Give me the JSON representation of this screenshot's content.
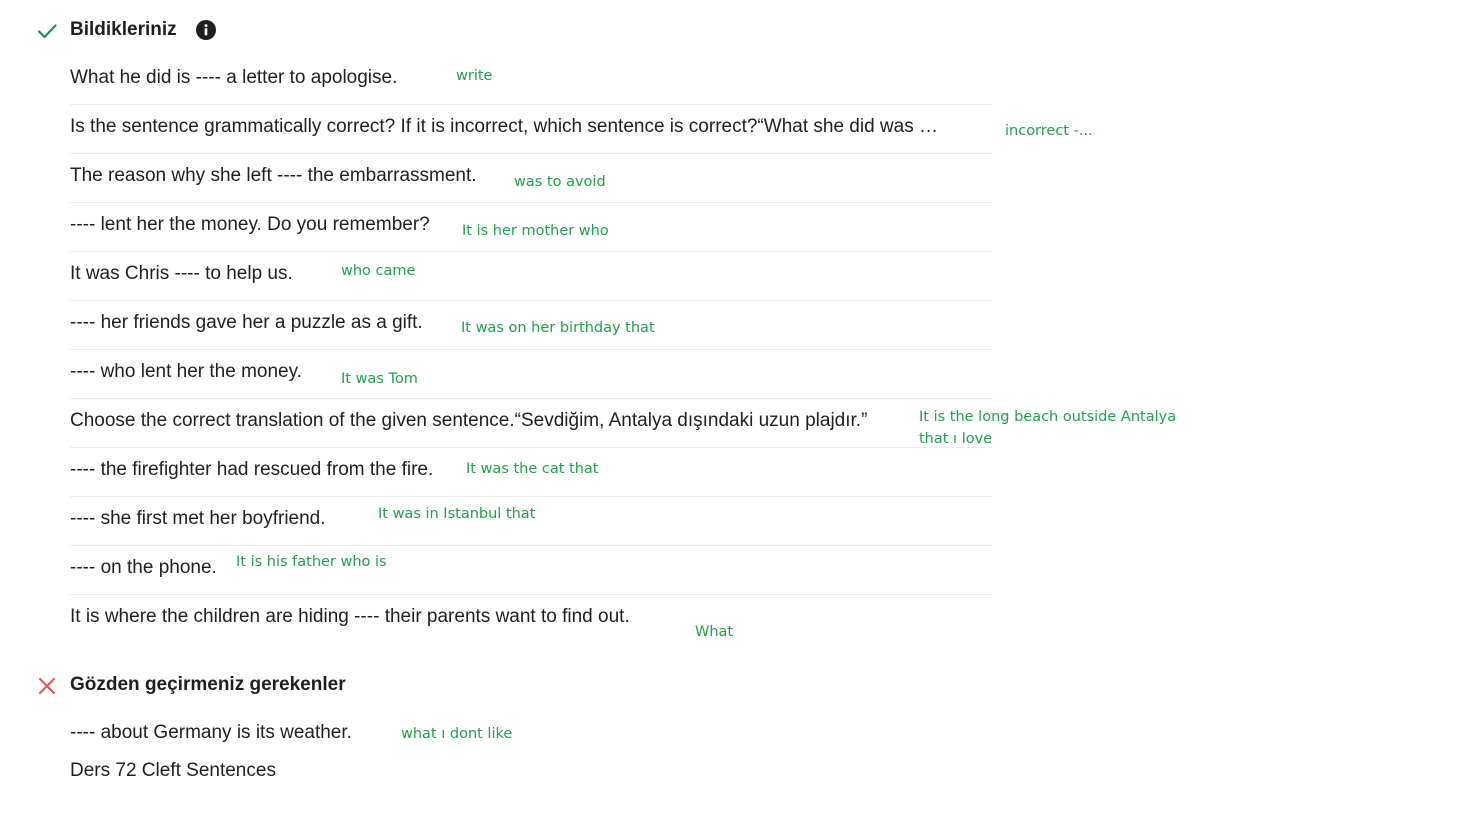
{
  "known_section": {
    "title": "Bildikleriniz",
    "status_icon": "check-icon",
    "status_color": "#1a8a6a",
    "info_icon": "info-icon"
  },
  "known_items": [
    {
      "question": "What he did is ---- a letter to apologise.",
      "answer": "write"
    },
    {
      "question": "Is the sentence grammatically correct? If it is incorrect, which sentence is correct?“What she did was …",
      "answer": "incorrect -..."
    },
    {
      "question": "The reason why she left ---- the embarrassment.",
      "answer": "was to avoid"
    },
    {
      "question": "---- lent her the money. Do you remember?",
      "answer": "It is her mother who"
    },
    {
      "question": "It was Chris ---- to help us.",
      "answer": "who came"
    },
    {
      "question": "---- her friends gave her a puzzle as a gift.",
      "answer": "It was on her birthday that"
    },
    {
      "question": "---- who lent her the money.",
      "answer": "It was Tom"
    },
    {
      "question": "Choose the correct translation of the given sentence.“Sevdiğim, Antalya dışındaki uzun plajdır.”",
      "answer": "It is the long beach outside Antalya that ı love"
    },
    {
      "question": "---- the firefighter had rescued from the fire.",
      "answer": "It was the cat that"
    },
    {
      "question": "---- she first met her boyfriend.",
      "answer": "It was in Istanbul that"
    },
    {
      "question": "---- on the phone.",
      "answer": "It is his father who is"
    },
    {
      "question": "It is where the children are hiding ---- their parents want to find out.",
      "answer": "What"
    }
  ],
  "review_section": {
    "title": "Gözden geçirmeniz gerekenler",
    "status_icon": "close-icon",
    "status_color": "#e05545"
  },
  "review_items": [
    {
      "question": "---- about Germany is its weather.",
      "answer": "what ı dont like"
    }
  ],
  "footer": {
    "text": "Ders 72 Cleft Sentences"
  },
  "colors": {
    "answer_green": "#22a04a",
    "text": "#1f1f1f",
    "divider": "#ececec"
  }
}
